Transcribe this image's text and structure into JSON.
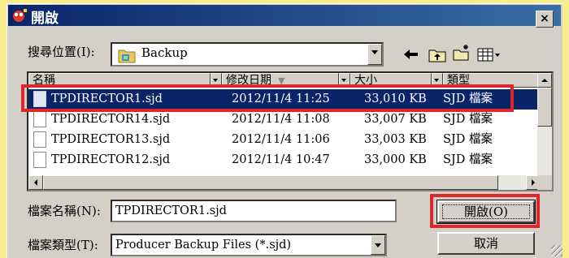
{
  "window": {
    "title": "開啟",
    "close_label": "×"
  },
  "location": {
    "label": "搜尋位置(I):",
    "value": "Backup"
  },
  "toolbar": {
    "back": "back-arrow-icon",
    "up": "up-folder-icon",
    "new_folder": "new-folder-icon",
    "view": "view-menu-icon"
  },
  "columns": [
    "名稱",
    "修改日期",
    "大小",
    "類型"
  ],
  "files": [
    {
      "name": "TPDIRECTOR1.sjd",
      "modified": "2012/11/4 11:25",
      "size": "33,010 KB",
      "type": "SJD 檔案",
      "selected": true
    },
    {
      "name": "TPDIRECTOR14.sjd",
      "modified": "2012/11/4 11:08",
      "size": "33,007 KB",
      "type": "SJD 檔案",
      "selected": false
    },
    {
      "name": "TPDIRECTOR13.sjd",
      "modified": "2012/11/4 11:06",
      "size": "33,003 KB",
      "type": "SJD 檔案",
      "selected": false
    },
    {
      "name": "TPDIRECTOR12.sjd",
      "modified": "2012/11/4 10:47",
      "size": "33,000 KB",
      "type": "SJD 檔案",
      "selected": false
    }
  ],
  "filename": {
    "label": "檔案名稱(N):",
    "value": "TPDIRECTOR1.sjd"
  },
  "filetype": {
    "label": "檔案類型(T):",
    "value": "Producer Backup Files (*.sjd)"
  },
  "buttons": {
    "open": "開啟(O)",
    "cancel": "取消"
  },
  "colors": {
    "highlight": "#e0252b",
    "selection": "#0a246a",
    "frame": "#f6ee8e"
  }
}
